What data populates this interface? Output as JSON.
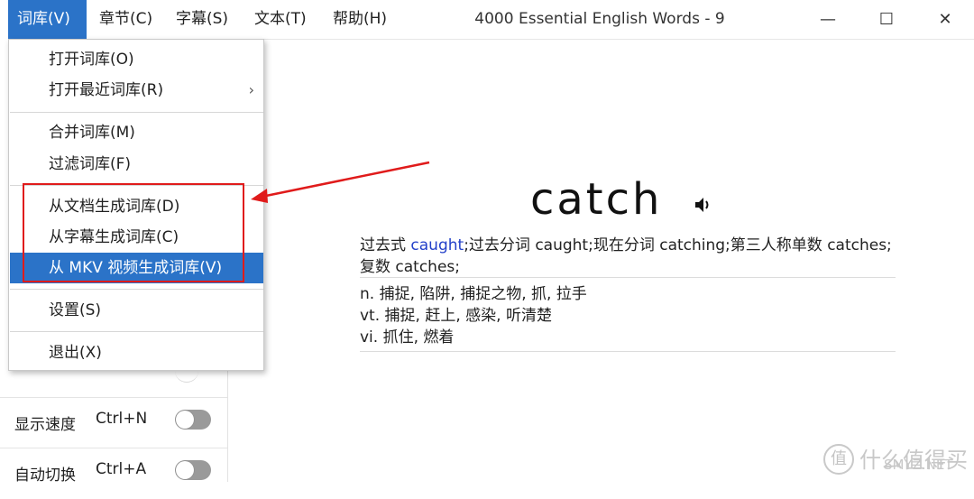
{
  "menubar": {
    "items": [
      "词库(V)",
      "章节(C)",
      "字幕(S)",
      "文本(T)",
      "帮助(H)"
    ],
    "active_index": 0
  },
  "window": {
    "title": "4000 Essential English Words - 9",
    "minimize": "—",
    "maximize": "☐",
    "close": "✕"
  },
  "dropdown": {
    "items": [
      "打开词库(O)",
      "打开最近词库(R)",
      "合并词库(M)",
      "过滤词库(F)",
      "从文档生成词库(D)",
      "从字幕生成词库(C)",
      "从 MKV 视频生成词库(V)",
      "设置(S)",
      "退出(X)"
    ],
    "submenu_arrow": "›",
    "highlighted_index": 6
  },
  "settings": [
    {
      "label": "显示速度",
      "shortcut": "Ctrl+N",
      "on": false
    },
    {
      "label": "自动切换",
      "shortcut": "Ctrl+A",
      "on": false
    }
  ],
  "word": {
    "text": "catch",
    "speaker_icon": "speaker-icon",
    "forms_prefix": "过去式 ",
    "forms_link": "caught",
    "forms_rest": ";过去分词 caught;现在分词 catching;第三人称单数 catches;复数 catches;",
    "definitions": [
      "n. 捕捉, 陷阱, 捕捉之物, 抓, 拉手",
      "vt. 捕捉, 赶上, 感染, 听清楚",
      "vi. 抓住, 燃着"
    ]
  },
  "watermark": {
    "icon_text": "值",
    "text": "什么值得买",
    "site": "SMYZ.NET"
  },
  "colors": {
    "accent": "#2b73c8",
    "annotation_red": "#e01b1b",
    "link_blue": "#2340c9"
  }
}
